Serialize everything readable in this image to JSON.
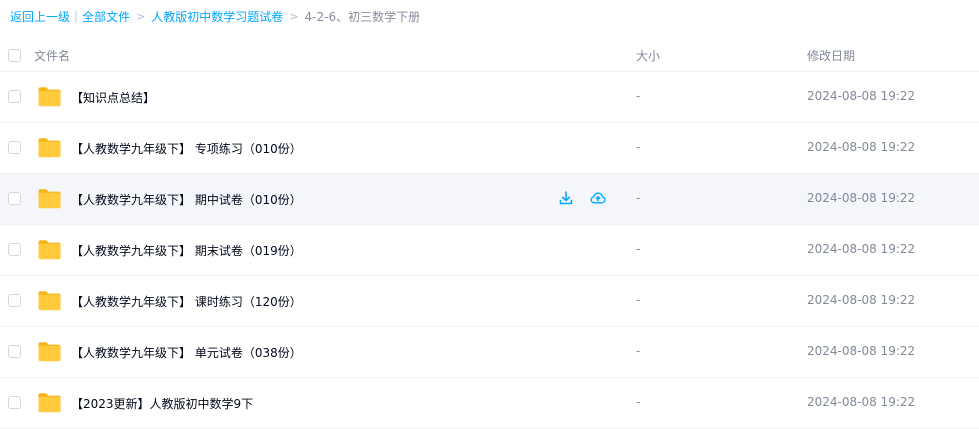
{
  "breadcrumb": {
    "back": "返回上一级",
    "bar": "|",
    "all_files": "全部文件",
    "parent": "人教版初中数学习题试卷",
    "sep": ">",
    "current": "4-2-6、初三数学下册"
  },
  "table": {
    "columns": {
      "name": "文件名",
      "size": "大小",
      "date": "修改日期"
    },
    "rows": [
      {
        "name": "【知识点总结】",
        "size": "-",
        "date": "2024-08-08 19:22"
      },
      {
        "name": "【人教数学九年级下】 专项练习（010份）",
        "size": "-",
        "date": "2024-08-08 19:22"
      },
      {
        "name": "【人教数学九年级下】 期中试卷（010份）",
        "size": "-",
        "date": "2024-08-08 19:22"
      },
      {
        "name": "【人教数学九年级下】 期末试卷（019份）",
        "size": "-",
        "date": "2024-08-08 19:22"
      },
      {
        "name": "【人教数学九年级下】 课时练习（120份）",
        "size": "-",
        "date": "2024-08-08 19:22"
      },
      {
        "name": "【人教数学九年级下】 单元试卷（038份）",
        "size": "-",
        "date": "2024-08-08 19:22"
      },
      {
        "name": "【2023更新】人教版初中数学9下",
        "size": "-",
        "date": "2024-08-08 19:22"
      }
    ]
  },
  "hovered_row_index": 2,
  "row_actions": [
    "download-icon",
    "cloud-upload-icon"
  ],
  "colors": {
    "link": "#06a7ff",
    "folder": "#ffcb3d",
    "hover_bg": "#f5f6fa",
    "muted_text": "#818999"
  }
}
